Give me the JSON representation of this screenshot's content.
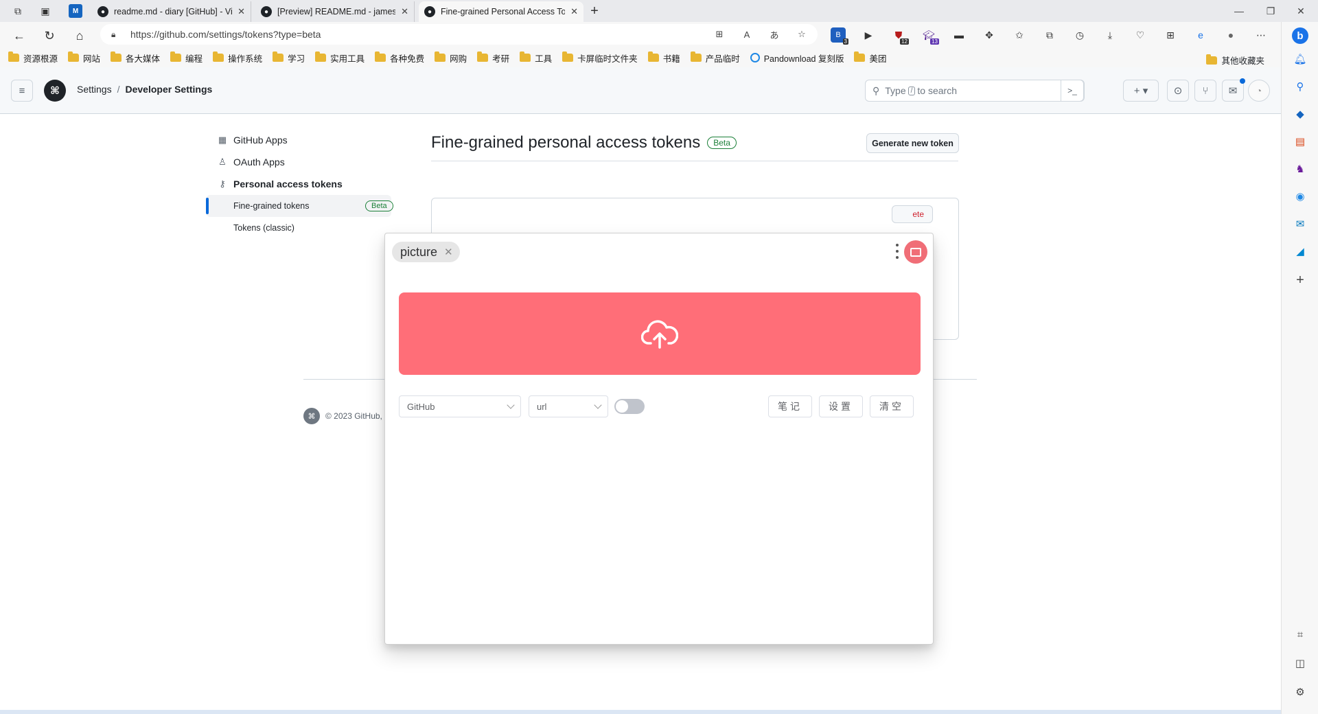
{
  "browser": {
    "tabs": [
      {
        "title": "readme.md - diary [GitHub] - Vi",
        "fav": "g"
      },
      {
        "title": "[Preview] README.md - james-c",
        "fav": "g"
      },
      {
        "title": "Fine-grained Personal Access To",
        "fav": "g",
        "active": true
      }
    ],
    "url": "https://github.com/settings/tokens?type=beta",
    "extension_badges": {
      "ext1": "3",
      "ext2": "12",
      "ext3": "13"
    },
    "bookmarks": [
      "资源根源",
      "网站",
      "各大媒体",
      "编程",
      "操作系统",
      "学习",
      "实用工具",
      "各种免费",
      "网购",
      "考研",
      "工具",
      "卡屏临时文件夹",
      "书籍",
      "产品临时"
    ],
    "bookmark_special": "Pandownload 复刻版",
    "bookmark_last": "美团",
    "bookmark_other": "其他收藏夹"
  },
  "github": {
    "breadcrumb": {
      "root": "Settings",
      "sep": "/",
      "current": "Developer Settings"
    },
    "search": {
      "pre": "Type",
      "key": "/",
      "post": "to search"
    },
    "nav": {
      "github_apps": "GitHub Apps",
      "oauth_apps": "OAuth Apps",
      "pat": "Personal access tokens",
      "fine_grained": "Fine-grained tokens",
      "fine_grained_badge": "Beta",
      "classic": "Tokens (classic)"
    },
    "title": "Fine-grained personal access tokens",
    "title_badge": "Beta",
    "generate_button": "Generate new token",
    "delete_label": "ete",
    "footer": "© 2023 GitHub,"
  },
  "popup": {
    "tag": "picture",
    "host_select": "GitHub",
    "format_select": "url",
    "toggle_on": false,
    "buttons": {
      "notes": "笔记",
      "settings": "设置",
      "clear": "清空"
    },
    "accent": "#ff6e78"
  }
}
